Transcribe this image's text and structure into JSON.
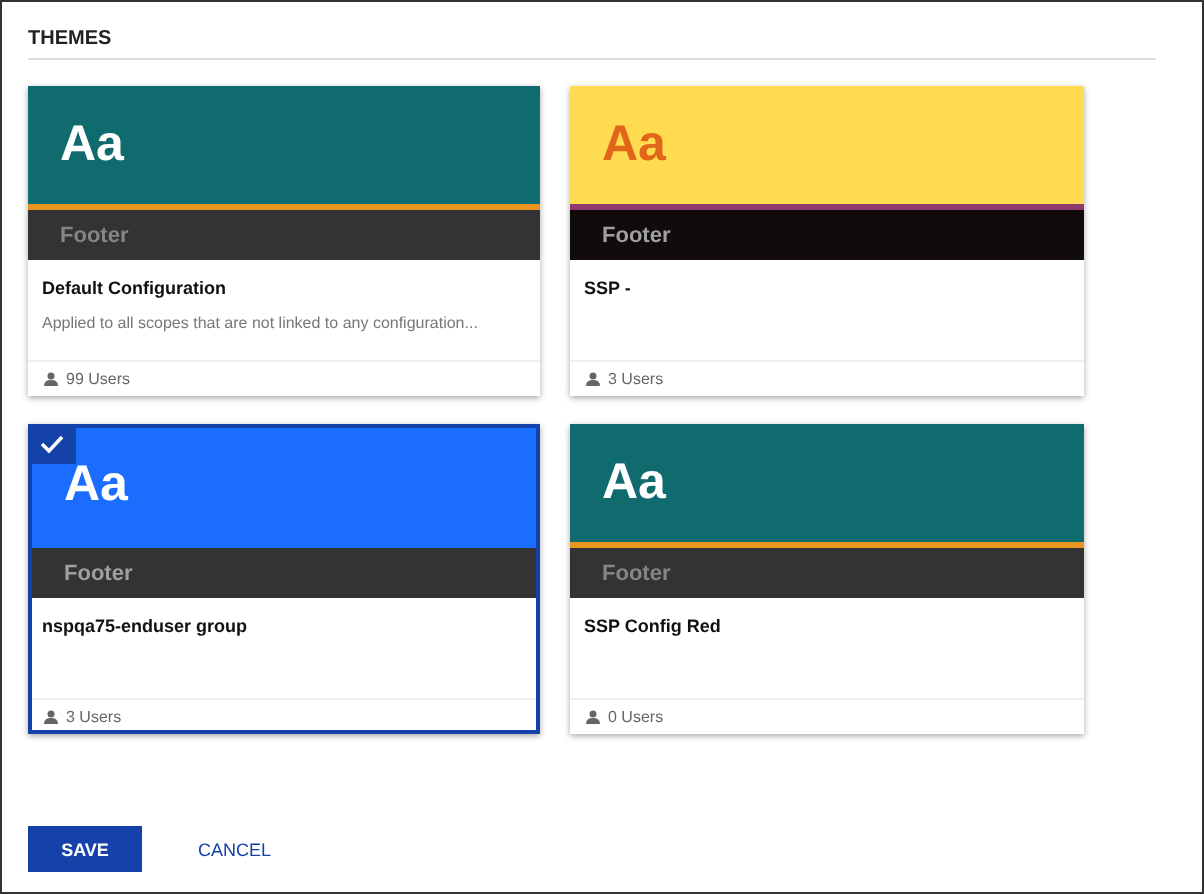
{
  "section_title": "THEMES",
  "themes": [
    {
      "kind": "teal",
      "sample": "Aa",
      "footer": "Footer",
      "name": "Default Configuration",
      "description": "Applied to all scopes that are not linked to any configuration...",
      "users": "99 Users",
      "selected": false
    },
    {
      "kind": "yellow",
      "sample": "Aa",
      "footer": "Footer",
      "name": "SSP -",
      "users": "3 Users",
      "selected": false
    },
    {
      "kind": "blue",
      "sample": "Aa",
      "footer": "Footer",
      "name": "nspqa75-enduser group",
      "users": "3 Users",
      "selected": true
    },
    {
      "kind": "teal",
      "sample": "Aa",
      "footer": "Footer",
      "name": "SSP Config Red",
      "users": "0 Users",
      "selected": false
    }
  ],
  "buttons": [
    {
      "label": "SAVE",
      "kind": "primary"
    },
    {
      "label": "CANCEL",
      "kind": "text"
    }
  ]
}
